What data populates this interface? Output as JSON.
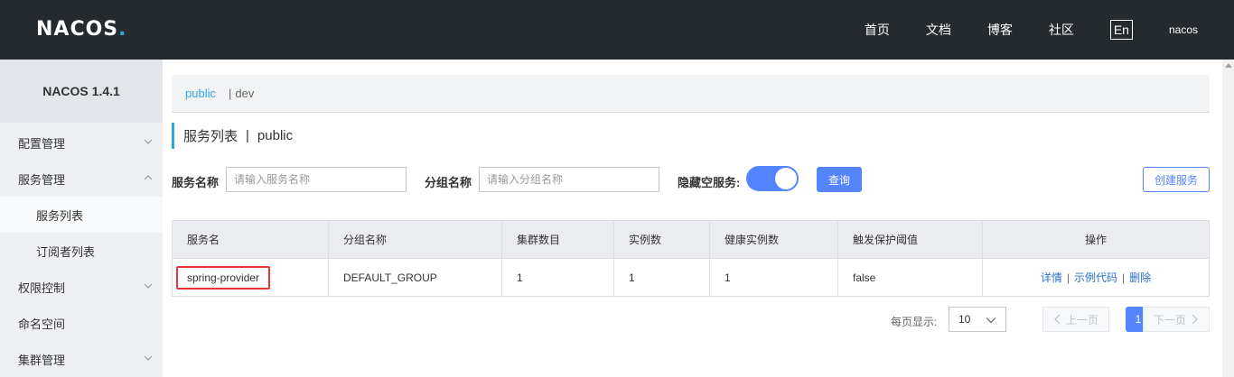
{
  "header": {
    "logo": "NACOS",
    "logo_dot": ".",
    "nav": [
      "首页",
      "文档",
      "博客",
      "社区"
    ],
    "lang": "En",
    "user": "nacos"
  },
  "sidebar": {
    "version": "NACOS 1.4.1",
    "items": [
      {
        "label": "配置管理",
        "chevron": "down"
      },
      {
        "label": "服务管理",
        "chevron": "up"
      },
      {
        "label": "服务列表"
      },
      {
        "label": "订阅者列表"
      },
      {
        "label": "权限控制",
        "chevron": "down"
      },
      {
        "label": "命名空间"
      },
      {
        "label": "集群管理",
        "chevron": "down"
      }
    ]
  },
  "namespaces": {
    "active": "public",
    "separator": "|",
    "other": "dev"
  },
  "page": {
    "title": "服务列表",
    "title_sep": "|",
    "namespace": "public"
  },
  "filters": {
    "service_name_label": "服务名称",
    "service_name_placeholder": "请输入服务名称",
    "group_name_label": "分组名称",
    "group_name_placeholder": "请输入分组名称",
    "hide_empty_label": "隐藏空服务:",
    "hide_empty_on": true,
    "query_button": "查询",
    "create_button": "创建服务"
  },
  "table": {
    "columns": [
      "服务名",
      "分组名称",
      "集群数目",
      "实例数",
      "健康实例数",
      "触发保护阈值",
      "操作"
    ],
    "rows": [
      {
        "service_name": "spring-provider",
        "group": "DEFAULT_GROUP",
        "clusters": "1",
        "instances": "1",
        "healthy": "1",
        "threshold": "false",
        "actions": [
          "详情",
          "示例代码",
          "删除"
        ]
      }
    ]
  },
  "pagination": {
    "page_size_label": "每页显示:",
    "page_size": "10",
    "prev": "上一页",
    "current": "1",
    "next": "下一页"
  },
  "colors": {
    "accent": "#2ea7e0",
    "primary": "#5584ff",
    "highlight": "#e53935"
  }
}
